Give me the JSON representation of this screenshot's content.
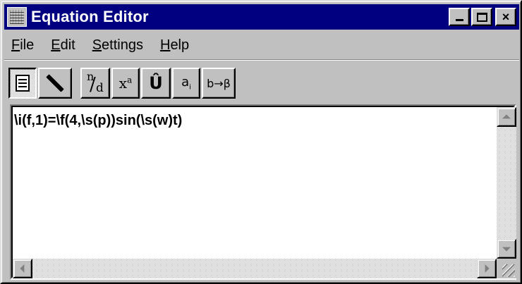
{
  "window": {
    "title": "Equation Editor",
    "controls": {
      "minimize_icon": "minimize-icon",
      "maximize_icon": "maximize-icon",
      "close_label": "×"
    }
  },
  "menu": {
    "items": [
      {
        "mnemonic": "F",
        "rest": "ile"
      },
      {
        "mnemonic": "E",
        "rest": "dit"
      },
      {
        "mnemonic": "S",
        "rest": "ettings"
      },
      {
        "mnemonic": "H",
        "rest": "elp"
      }
    ]
  },
  "toolbar": {
    "buttons": [
      {
        "name": "field-code-view",
        "icon": "document-icon",
        "pressed": true
      },
      {
        "name": "draw-mode",
        "icon": "pen-icon",
        "pressed": false
      },
      {
        "name": "fraction",
        "numerator": "n",
        "slash": "/",
        "denominator": "d"
      },
      {
        "name": "superscript",
        "base": "x",
        "exponent": "a"
      },
      {
        "name": "accent",
        "label": "Û"
      },
      {
        "name": "subscript",
        "base": "a",
        "index": "i"
      },
      {
        "name": "transform",
        "label": "b→β"
      }
    ]
  },
  "editor": {
    "content": "\\i(f,1)=\\f(4,\\s(p))sin(\\s(w)t)"
  },
  "colors": {
    "titlebar": "#000080",
    "face": "#c0c0c0",
    "editor_bg": "#ffffff"
  }
}
